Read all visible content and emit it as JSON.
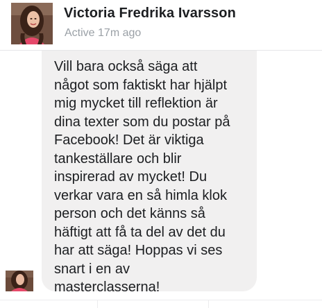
{
  "header": {
    "contact_name": "Victoria Fredrika Ivarsson",
    "status": "Active 17m ago",
    "avatar_icon": "profile-photo"
  },
  "thread": {
    "message_text": "Vill bara också säga att\nnågot som faktiskt har hjälpt\nmig mycket till reflektion är\ndina texter som du postar på\nFacebook! Det är viktiga\ntankeställare och blir\ninspirerad av mycket! Du\nverkar vara en så himla klok\nperson och det känns så\nhäftigt att få ta del av det du\nhar att säga! Hoppas vi ses\nsnart i en av\nmasterclasserna!",
    "bubble_color": "#f1f0f0",
    "text_color": "#1c1e21",
    "sender_avatar_icon": "profile-photo"
  },
  "colors": {
    "header_background": "#ffffff",
    "status_gray": "#9aa0a6",
    "divider": "#e6e6e8"
  }
}
